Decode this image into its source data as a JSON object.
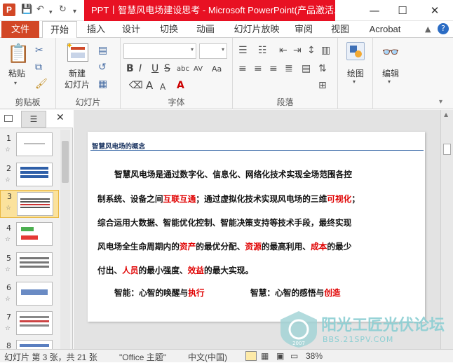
{
  "titlebar": {
    "title": "PPT丨智慧风电场建设思考  -  Microsoft PowerPoint(产品激活...",
    "app_icon": "P",
    "minimize": "—",
    "maximize": "☐",
    "close": "✕"
  },
  "tabs": {
    "file": "文件",
    "home": "开始",
    "insert": "插入",
    "design": "设计",
    "transitions": "切换",
    "animations": "动画",
    "slideshow": "幻灯片放映",
    "review": "审阅",
    "view": "视图",
    "acrobat": "Acrobat"
  },
  "ribbon": {
    "clipboard": {
      "label": "剪贴板",
      "paste": "粘贴"
    },
    "slides": {
      "label": "幻灯片",
      "new_slide_1": "新建",
      "new_slide_2": "幻灯片"
    },
    "font": {
      "label": "字体",
      "bold": "B",
      "italic": "I",
      "underline": "U",
      "strike": "S",
      "shadow": "abc",
      "spacing": "AV",
      "case": "Aa",
      "grow": "A",
      "shrink": "A"
    },
    "paragraph": {
      "label": "段落"
    },
    "drawing": {
      "label": "绘图"
    },
    "editing": {
      "label": "编辑"
    }
  },
  "thumbnails": [
    {
      "num": "1"
    },
    {
      "num": "2"
    },
    {
      "num": "3"
    },
    {
      "num": "4"
    },
    {
      "num": "5"
    },
    {
      "num": "6"
    },
    {
      "num": "7"
    },
    {
      "num": "8"
    }
  ],
  "slide": {
    "title": "智慧风电场的概念",
    "l1": "智慧风电场是通过数字化、信息化、网络化技术实现全场范围各控",
    "l2a": "制系统、设备之间",
    "l2b": "互联互通",
    "l2c": "；通过虚拟化技术实现风电场的三维",
    "l2d": "可视化",
    "l2e": "；",
    "l3": "综合运用大数据、智能优化控制、智能决策支持等技术手段，最终实现",
    "l4a": "风电场全生命周期内的",
    "l4b": "资产",
    "l4c": "的最优分配、",
    "l4d": "资源",
    "l4e": "的最高利用、",
    "l4f": "成本",
    "l4g": "的最少",
    "l5a": "付出、",
    "l5b": "人员",
    "l5c": "的最小强度、",
    "l5d": "效益",
    "l5e": "的最大实现。",
    "l6a": "智能：心智的唤醒与",
    "l6b": "执行",
    "l6c": "智慧：心智的感悟与",
    "l6d": "创造"
  },
  "status": {
    "slide_info": "幻灯片 第 3 张，共 21 张",
    "theme": "\"Office 主题\"",
    "language": "中文(中国)",
    "zoom": "38%"
  },
  "watermark": {
    "brand": "阳光工匠光伏论坛",
    "url": "BBS.21SPV.COM",
    "year": "2007"
  }
}
